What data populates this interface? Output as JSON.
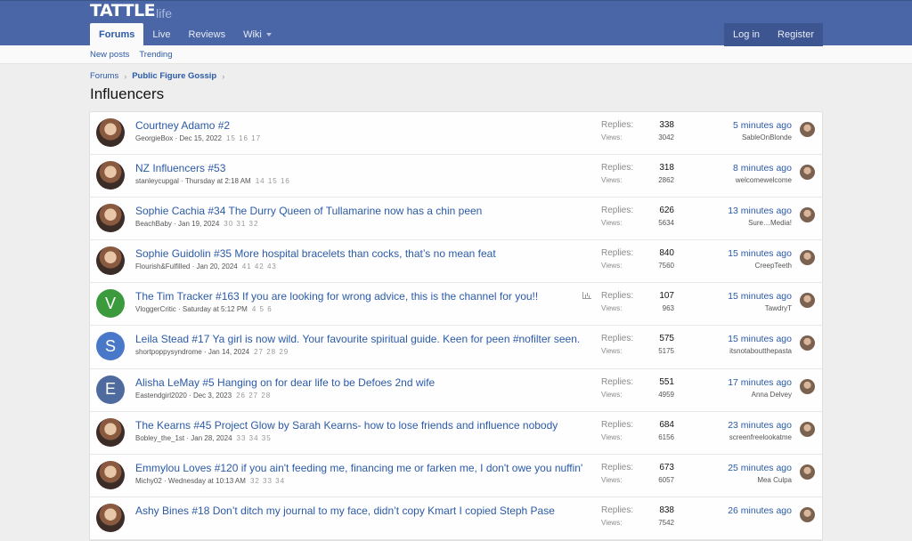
{
  "header": {
    "logo_main": "TATTLE",
    "logo_sub": "life",
    "nav": [
      {
        "label": "Forums"
      },
      {
        "label": "Live"
      },
      {
        "label": "Reviews"
      },
      {
        "label": "Wiki"
      }
    ],
    "login_label": "Log in",
    "register_label": "Register"
  },
  "subnav": {
    "new_posts": "New posts",
    "trending": "Trending"
  },
  "breadcrumb": {
    "forums": "Forums",
    "section": "Public Figure Gossip"
  },
  "page_title": "Influencers",
  "labels": {
    "replies": "Replies:",
    "views": "Views:"
  },
  "threads": [
    {
      "title": "Courtney Adamo #2",
      "author": "GeorgieBox",
      "date": "Dec 15, 2022",
      "pages": "15 16 17",
      "replies": "338",
      "views": "3042",
      "last_time": "5 minutes ago",
      "last_user": "SableOnBlonde",
      "avatar_letter": "",
      "avatar_color": "#4a2a2a",
      "chart": false
    },
    {
      "title": "NZ Influencers #53",
      "author": "stanleycupgal",
      "date": "Thursday at 2:18 AM",
      "pages": "14 15 16",
      "replies": "318",
      "views": "2862",
      "last_time": "8 minutes ago",
      "last_user": "welcomewelcome",
      "avatar_letter": "",
      "avatar_color": "#9a7a88",
      "chart": false
    },
    {
      "title": "Sophie Cachia #34 The Durry Queen of Tullamarine now has a chin peen",
      "author": "BeachBaby",
      "date": "Jan 19, 2024",
      "pages": "30 31 32",
      "replies": "626",
      "views": "5634",
      "last_time": "13 minutes ago",
      "last_user": "Sure…Media!",
      "avatar_letter": "",
      "avatar_color": "#3a3020",
      "chart": false
    },
    {
      "title": "Sophie Guidolin #35 More hospital bracelets than cocks, that’s no mean feat",
      "author": "Flourish&Fulfilled",
      "date": "Jan 20, 2024",
      "pages": "41 42 43",
      "replies": "840",
      "views": "7560",
      "last_time": "15 minutes ago",
      "last_user": "CreepTeeth",
      "avatar_letter": "",
      "avatar_color": "#c0a070",
      "chart": false
    },
    {
      "title": "The Tim Tracker #163 If you are looking for wrong advice, this is the channel for you!!",
      "author": "VloggerCritic",
      "date": "Saturday at 5:12 PM",
      "pages": "4 5 6",
      "replies": "107",
      "views": "963",
      "last_time": "15 minutes ago",
      "last_user": "TawdryT",
      "avatar_letter": "V",
      "avatar_color": "#3b9a3b",
      "chart": true
    },
    {
      "title": "Leila Stead #17 Ya girl is now wild. Your favourite spiritual guide. Keen for peen #nofilter seen.",
      "author": "shortpoppysyndrome",
      "date": "Jan 14, 2024",
      "pages": "27 28 29",
      "replies": "575",
      "views": "5175",
      "last_time": "15 minutes ago",
      "last_user": "itsnotaboutthepasta",
      "avatar_letter": "S",
      "avatar_color": "#4a78c8",
      "chart": false
    },
    {
      "title": "Alisha LeMay #5 Hanging on for dear life to be Defoes 2nd wife",
      "author": "Eastendgirl2020",
      "date": "Dec 3, 2023",
      "pages": "26 27 28",
      "replies": "551",
      "views": "4959",
      "last_time": "17 minutes ago",
      "last_user": "Anna Delvey",
      "avatar_letter": "E",
      "avatar_color": "#4e6a9e",
      "chart": false
    },
    {
      "title": "The Kearns #45 Project Glow by Sarah Kearns- how to lose friends and influence nobody",
      "author": "Bobley_the_1st",
      "date": "Jan 28, 2024",
      "pages": "33 34 35",
      "replies": "684",
      "views": "6156",
      "last_time": "23 minutes ago",
      "last_user": "screenfreelookatme",
      "avatar_letter": "",
      "avatar_color": "#c8b098",
      "chart": false
    },
    {
      "title": "Emmylou Loves #120 if you ain't feeding me, financing me or farken me, I don't owe you nuffin'",
      "author": "Michy02",
      "date": "Wednesday at 10:13 AM",
      "pages": "32 33 34",
      "replies": "673",
      "views": "6057",
      "last_time": "25 minutes ago",
      "last_user": "Mea Culpa",
      "avatar_letter": "",
      "avatar_color": "#8a5040",
      "chart": false
    },
    {
      "title": "Ashy Bines #18 Don’t ditch my journal to my face, didn’t copy Kmart I copied Steph Pase",
      "author": "",
      "date": "",
      "pages": "",
      "replies": "838",
      "views": "7542",
      "last_time": "26 minutes ago",
      "last_user": "",
      "avatar_letter": "",
      "avatar_color": "#d0b090",
      "chart": false
    }
  ],
  "colors": {
    "header_bg": "#4a66a6",
    "link": "#2b5aa8",
    "page_bg": "#eeeeee"
  }
}
